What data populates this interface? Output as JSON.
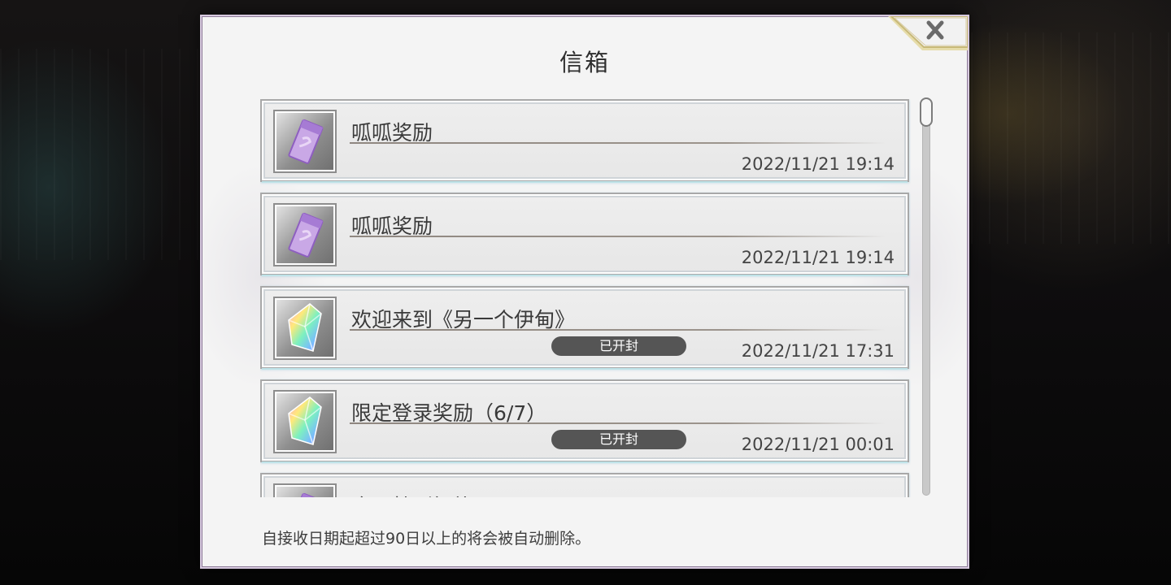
{
  "window": {
    "title": "信箱",
    "close_icon": "close-x-icon"
  },
  "colors": {
    "panel_bg": "#f4f4f4",
    "badge_bg": "#555555",
    "accent_gold": "#d6c27a"
  },
  "mail_list": {
    "items": [
      {
        "title": "呱呱奖励",
        "date": "2022/11/21 19:14",
        "icon": "ticket-icon",
        "opened": false,
        "badge": ""
      },
      {
        "title": "呱呱奖励",
        "date": "2022/11/21 19:14",
        "icon": "ticket-icon",
        "opened": false,
        "badge": ""
      },
      {
        "title": "欢迎来到《另一个伊甸》",
        "date": "2022/11/21 17:31",
        "icon": "crystal-icon",
        "opened": true,
        "badge": "已开封"
      },
      {
        "title": "限定登录奖励（6/7）",
        "date": "2022/11/21 00:01",
        "icon": "crystal-icon",
        "opened": true,
        "badge": "已开封"
      },
      {
        "title": "今日特别好礼",
        "date": "",
        "icon": "ticket-icon",
        "opened": false,
        "badge": ""
      }
    ]
  },
  "footer": {
    "note": "自接收日期起超过90日以上的将会被自动删除。"
  }
}
